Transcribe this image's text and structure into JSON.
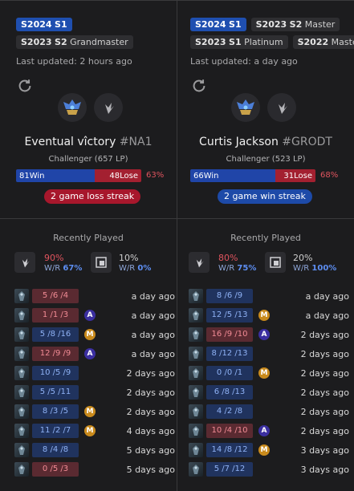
{
  "left": {
    "tags_row1": [
      {
        "season": "S2024",
        "split": "S1",
        "tier": "",
        "primary": true
      }
    ],
    "tags_row2": [
      {
        "season": "S2023",
        "split": "S2",
        "tier": "Grandmaster",
        "primary": false
      }
    ],
    "updated": "Last updated: 2 hours ago",
    "name": "Eventual vîctory",
    "tagline": "#NA1",
    "rank": "Challenger (657 LP)",
    "wins": "81Win",
    "losses": "48Lose",
    "win_fraction": 0.63,
    "winrate": "63%",
    "streak": "2 game loss streak",
    "recent_title": "Recently Played",
    "role1_pct": "90%",
    "role1_wr_label": "W/R",
    "role1_wr": "67%",
    "role2_pct": "10%",
    "role2_wr_label": "W/R",
    "role2_wr": "0%",
    "games": [
      {
        "kda": "5 /6 /4",
        "result": "lose",
        "badge": "",
        "when": "a day ago"
      },
      {
        "kda": "1 /1 /3",
        "result": "lose",
        "badge": "A",
        "when": "a day ago"
      },
      {
        "kda": "5 /8 /16",
        "result": "win",
        "badge": "M",
        "when": "a day ago"
      },
      {
        "kda": "12 /9 /9",
        "result": "lose",
        "badge": "A",
        "when": "a day ago"
      },
      {
        "kda": "10 /5 /9",
        "result": "win",
        "badge": "",
        "when": "2 days ago"
      },
      {
        "kda": "5 /5 /11",
        "result": "win",
        "badge": "",
        "when": "2 days ago"
      },
      {
        "kda": "8 /3 /5",
        "result": "win",
        "badge": "M",
        "when": "2 days ago"
      },
      {
        "kda": "11 /2 /7",
        "result": "win",
        "badge": "M",
        "when": "4 days ago"
      },
      {
        "kda": "8 /4 /8",
        "result": "win",
        "badge": "",
        "when": "5 days ago"
      },
      {
        "kda": "0 /5 /3",
        "result": "lose",
        "badge": "",
        "when": "5 days ago"
      }
    ]
  },
  "right": {
    "tags_row1": [
      {
        "season": "S2024",
        "split": "S1",
        "tier": "",
        "primary": true
      },
      {
        "season": "S2023",
        "split": "S2",
        "tier": "Master",
        "primary": false
      }
    ],
    "tags_row2": [
      {
        "season": "S2023",
        "split": "S1",
        "tier": "Platinum",
        "primary": false
      },
      {
        "season": "S2022",
        "split": "",
        "tier": "Master",
        "primary": false
      }
    ],
    "updated": "Last updated: a day ago",
    "name": "Curtis Jackson",
    "tagline": "#GRODT",
    "rank": "Challenger (523 LP)",
    "wins": "66Win",
    "losses": "31Lose",
    "win_fraction": 0.68,
    "winrate": "68%",
    "streak": "2 game win streak",
    "recent_title": "Recently Played",
    "role1_pct": "80%",
    "role1_wr_label": "W/R",
    "role1_wr": "75%",
    "role2_pct": "20%",
    "role2_wr_label": "W/R",
    "role2_wr": "100%",
    "games": [
      {
        "kda": "8 /6 /9",
        "result": "win",
        "badge": "",
        "when": "a day ago"
      },
      {
        "kda": "12 /5 /13",
        "result": "win",
        "badge": "M",
        "when": "a day ago"
      },
      {
        "kda": "16 /9 /10",
        "result": "lose",
        "badge": "A",
        "when": "2 days ago"
      },
      {
        "kda": "8 /12 /13",
        "result": "win",
        "badge": "",
        "when": "2 days ago"
      },
      {
        "kda": "0 /0 /1",
        "result": "win",
        "badge": "M",
        "when": "2 days ago"
      },
      {
        "kda": "6 /8 /13",
        "result": "win",
        "badge": "",
        "when": "2 days ago"
      },
      {
        "kda": "4 /2 /8",
        "result": "win",
        "badge": "",
        "when": "2 days ago"
      },
      {
        "kda": "10 /4 /10",
        "result": "lose",
        "badge": "A",
        "when": "2 days ago"
      },
      {
        "kda": "14 /8 /12",
        "result": "win",
        "badge": "M",
        "when": "3 days ago"
      },
      {
        "kda": "5 /7 /12",
        "result": "win",
        "badge": "",
        "when": "3 days ago"
      }
    ]
  },
  "colors": {
    "win": "#2045a8",
    "lose": "#a32030",
    "accent": "#5d8ef2",
    "danger": "#e0545e"
  }
}
